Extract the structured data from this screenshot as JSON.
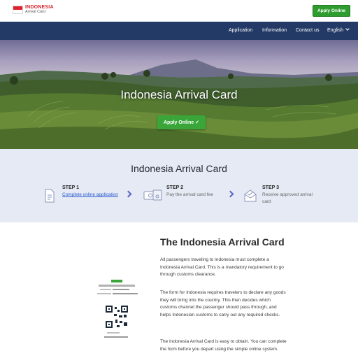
{
  "header": {
    "logo_title": "INDONESIA",
    "logo_subtitle": "Arrival Card",
    "apply_button": "Apply Online"
  },
  "nav": {
    "items": [
      {
        "label": "Application"
      },
      {
        "label": "Information"
      },
      {
        "label": "Contact us"
      },
      {
        "label": "English"
      }
    ]
  },
  "hero": {
    "title": "Indonesia Arrival Card",
    "button": "Apply Online ✓"
  },
  "steps": {
    "title": "Indonesia Arrival Card",
    "items": [
      {
        "label": "STEP 1",
        "text": "Complete online application",
        "icon": "document-icon"
      },
      {
        "label": "STEP 2",
        "text": "Pay the arrival card fee",
        "icon": "payment-icon"
      },
      {
        "label": "STEP 3",
        "text": "Receive approved arrival card",
        "icon": "email-icon"
      }
    ]
  },
  "main": {
    "title": "The Indonesia Arrival Card",
    "paragraphs": [
      "All passengers traveling to Indonesia must complete a Indonesia Arrival Card. This is a mandatory requirement to go through customs clearance.",
      "The form for Indonesia requires travelers to declare any goods they will bring into the country. This then decides which customs channel the passenger should pass through, and helps Indonesian customs to carry out any required checks.",
      "The Indonesia Arrival Card is easy to obtain. You can complete the form before you depart using the simple online system."
    ]
  },
  "colors": {
    "nav_bg": "#233a66",
    "button_green": "#2e9c2e",
    "steps_bg": "#e5eaf4",
    "link": "#2b5bd1",
    "flag_red": "#e0202a"
  }
}
